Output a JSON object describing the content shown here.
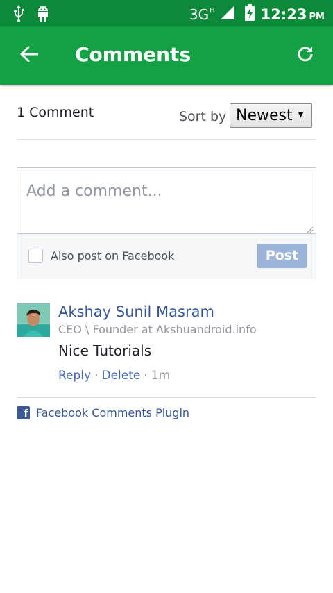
{
  "status_bar": {
    "icons": [
      "usb-icon",
      "android-debug-icon",
      "signal-icon",
      "battery-charging-icon"
    ],
    "network": "3G",
    "network_sup": "H",
    "time": "12:23",
    "ampm": "PM"
  },
  "app_bar": {
    "title": "Comments",
    "back_icon": "arrow-back-icon",
    "refresh_icon": "refresh-icon",
    "color": "#13a144"
  },
  "comments_header": {
    "count_label": "1 Comment",
    "sort_label": "Sort by",
    "sort_selected": "Newest"
  },
  "composer": {
    "placeholder": "Add a comment...",
    "checkbox_label": "Also post on Facebook",
    "checkbox_checked": false,
    "post_label": "Post"
  },
  "comments": [
    {
      "author": "Akshay Sunil Masram",
      "subtitle": "CEO \\ Founder at Akshuandroid.info",
      "text": "Nice Tutorials",
      "reply_label": "Reply",
      "delete_label": "Delete",
      "time": "1m"
    }
  ],
  "footer": {
    "plugin_label": "Facebook Comments Plugin",
    "icon": "facebook-icon"
  }
}
